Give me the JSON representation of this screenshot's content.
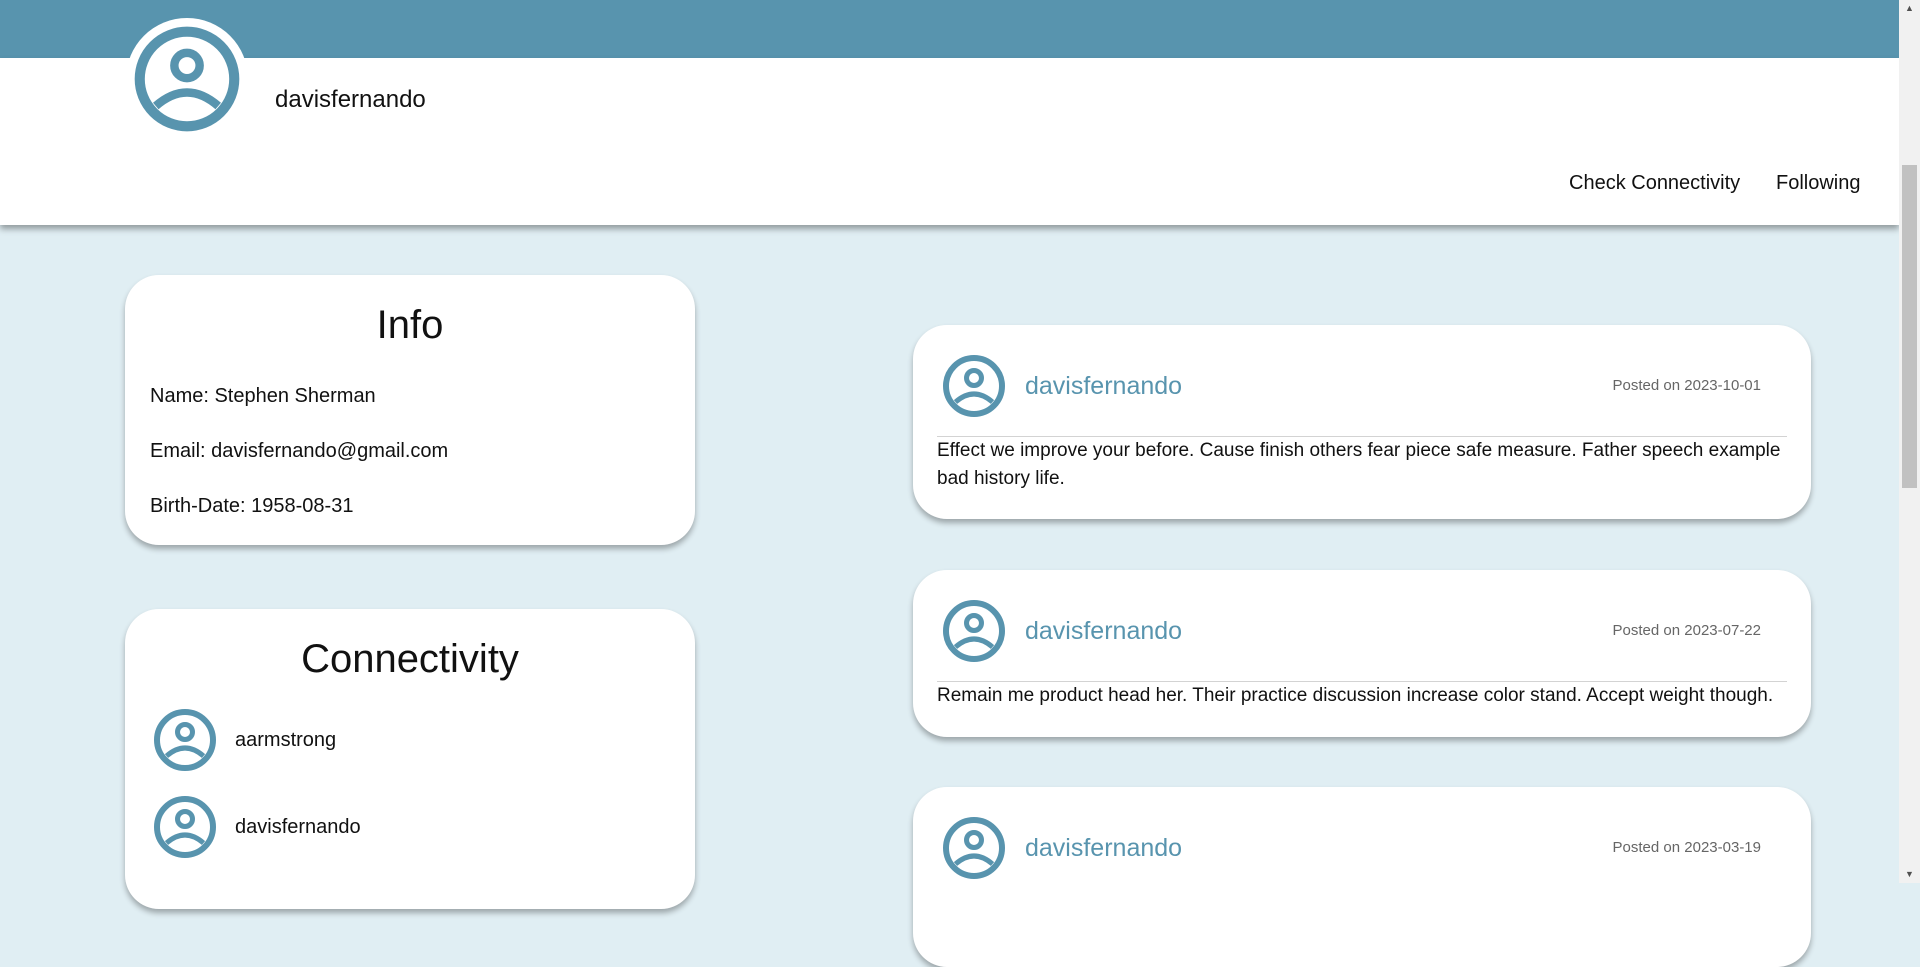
{
  "brand": {
    "accent": "#5894ae",
    "background": "#e0eef3"
  },
  "profile": {
    "username": "davisfernando",
    "avatar_icon": "user-circle-icon"
  },
  "nav": {
    "check_connectivity": "Check Connectivity",
    "following": "Following"
  },
  "info": {
    "title": "Info",
    "name_line": "Name: Stephen Sherman",
    "email_line": "Email: davisfernando@gmail.com",
    "birth_line": "Birth-Date: 1958-08-31"
  },
  "connectivity": {
    "title": "Connectivity",
    "items": [
      {
        "name": "aarmstrong"
      },
      {
        "name": "davisfernando"
      }
    ]
  },
  "posts": [
    {
      "user": "davisfernando",
      "date": "Posted on 2023-10-01",
      "body": "Effect we improve your before. Cause finish others fear piece safe measure. Father speech example bad history life."
    },
    {
      "user": "davisfernando",
      "date": "Posted on 2023-07-22",
      "body": "Remain me product head her. Their practice discussion increase color stand. Accept weight though."
    },
    {
      "user": "davisfernando",
      "date": "Posted on 2023-03-19",
      "body": ""
    }
  ]
}
